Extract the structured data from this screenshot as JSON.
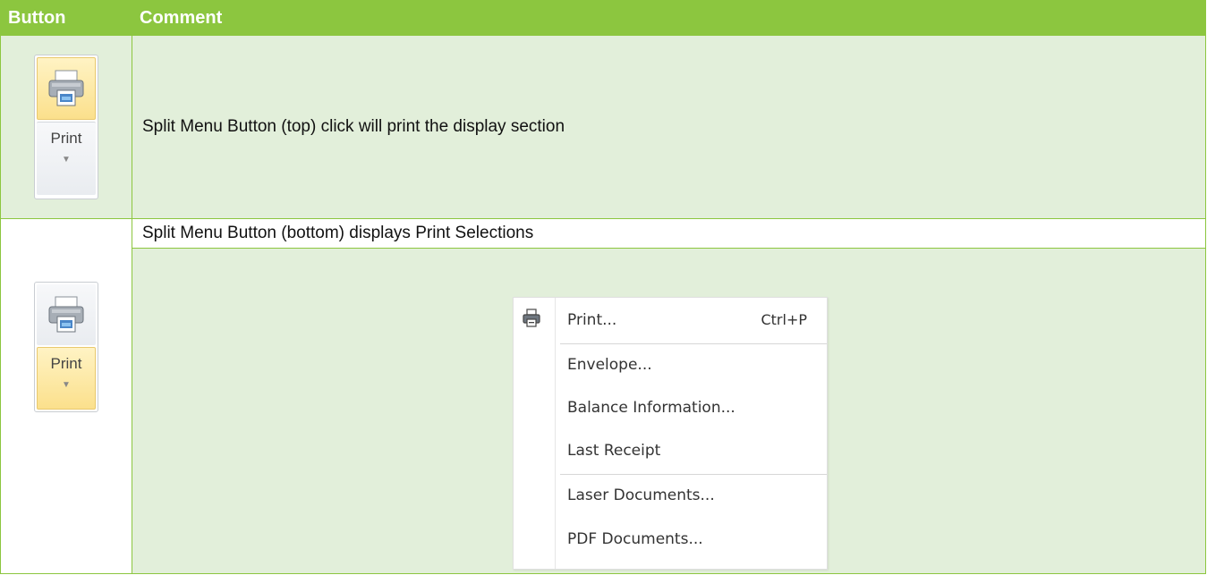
{
  "table": {
    "headers": [
      "Button",
      "Comment"
    ],
    "row1": {
      "button_label": "Print",
      "comment": "Split Menu Button (top) click will print the display section"
    },
    "row2": {
      "button_label": "Print",
      "comment": "Split Menu Button (bottom) displays Print Selections"
    }
  },
  "menu": {
    "items": [
      {
        "label": "Print...",
        "shortcut": "Ctrl+P"
      },
      {
        "label": "Envelope..."
      },
      {
        "label": "Balance Information..."
      },
      {
        "label": "Last Receipt"
      },
      {
        "label": "Laser Documents..."
      },
      {
        "label": "PDF Documents..."
      }
    ]
  },
  "colors": {
    "header_bg": "#8cc63f",
    "row_bg": "#e2efda",
    "highlight": "#fbe08c"
  },
  "icons": [
    "printer-icon",
    "chevron-down-icon"
  ]
}
